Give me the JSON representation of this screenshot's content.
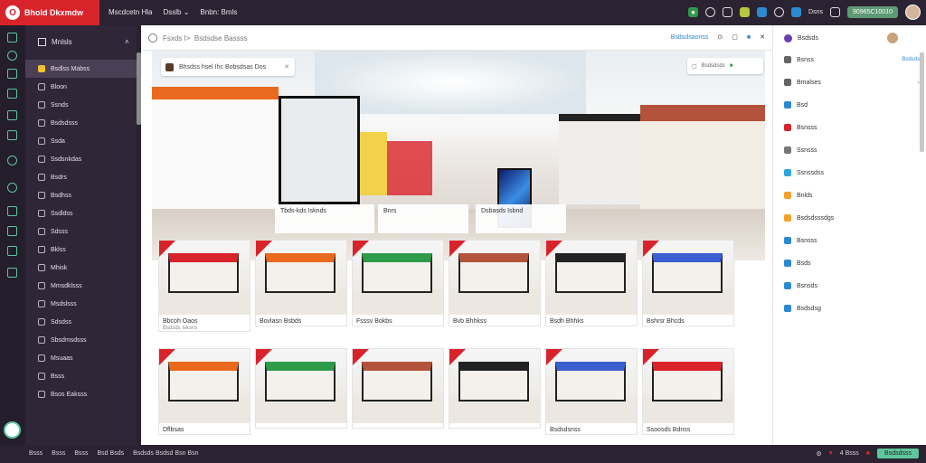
{
  "app": {
    "logo_letter": "O",
    "name": "Bhold Dkxmdw",
    "accent": "#d9232b"
  },
  "topnav": [
    "Mscdcetn Hla",
    "Dsslb",
    "Bnbn: Bmls"
  ],
  "topbar_right": {
    "label": "Dsns",
    "wallet": "90965C10010"
  },
  "sidebar": {
    "header": "Mnlsls",
    "items": [
      {
        "label": "Bsdlss Mabss"
      },
      {
        "label": "Bloon"
      },
      {
        "label": "Ssnds"
      },
      {
        "label": "Bsdsdsss"
      },
      {
        "label": "Ssda"
      },
      {
        "label": "Ssdsnkdas"
      },
      {
        "label": "Bsdrs"
      },
      {
        "label": "Bsdhss"
      },
      {
        "label": "Ssdldss"
      },
      {
        "label": "Sdsss"
      },
      {
        "label": "Bklss"
      },
      {
        "label": "Mhisk"
      },
      {
        "label": "Mmsdklsss"
      },
      {
        "label": "Msdslsss"
      },
      {
        "label": "Sdsdss"
      },
      {
        "label": "Sbsdmsdsss"
      },
      {
        "label": "Msuaas"
      },
      {
        "label": "Bsss"
      },
      {
        "label": "Bsos Eaksss"
      }
    ]
  },
  "search": {
    "prefix": "Fsxds I>",
    "text": "Bsdsdse Bassss",
    "link": "Bsdsdsaonss"
  },
  "hero": {
    "search_text": "Bhsdss hsel Ihc Bobsdsas Dos",
    "pill_text": "Bsdsdsds",
    "labels": [
      {
        "title": "Tbds-kds Isknds",
        "sub": ""
      },
      {
        "title": "Bnrs",
        "sub": ""
      },
      {
        "title": "Dsbasds Isbnd",
        "sub": ""
      }
    ]
  },
  "cards": [
    {
      "title": "Bbcoh Oaos",
      "sub": "Bsdsds Isksns"
    },
    {
      "title": "Bovlasn Bsbds",
      "sub": ""
    },
    {
      "title": "Fsssv Bokbs",
      "sub": ""
    },
    {
      "title": "Bvb Bhhkss",
      "sub": ""
    },
    {
      "title": "Bsdh Bhhks",
      "sub": ""
    },
    {
      "title": "Bshrsr Bhcds",
      "sub": ""
    },
    {
      "title": "Dflbsas",
      "sub": ""
    },
    {
      "title": "",
      "sub": ""
    },
    {
      "title": "",
      "sub": ""
    },
    {
      "title": "",
      "sub": ""
    },
    {
      "title": "Bsdsdsnss",
      "sub": ""
    },
    {
      "title": "Ssoosds Bdnss",
      "sub": ""
    }
  ],
  "rpanel": {
    "header": "Bsdsds",
    "items": [
      {
        "label": "Bsnss",
        "extra": "Bsdsds",
        "color": "#666"
      },
      {
        "label": "Bmalses",
        "extra": "",
        "color": "#666"
      },
      {
        "label": "Bsd",
        "extra": "",
        "color": "#2a8ad0"
      },
      {
        "label": "Bsnsss",
        "extra": "",
        "color": "#d9232b"
      },
      {
        "label": "Ssnsss",
        "extra": "",
        "color": "#777"
      },
      {
        "label": "Ssnssdss",
        "extra": "",
        "color": "#2aa7d8"
      },
      {
        "label": "Bnlds",
        "extra": "",
        "color": "#f2a12c"
      },
      {
        "label": "Bsdsdsssdgs",
        "extra": "",
        "color": "#f2a12c"
      },
      {
        "label": "Bsnsss",
        "extra": "",
        "color": "#2a8ad0"
      },
      {
        "label": "Bsds",
        "extra": "",
        "color": "#2a8ad0"
      },
      {
        "label": "Bsnsds",
        "extra": "",
        "color": "#2a8ad0"
      },
      {
        "label": "Bsdsdsg",
        "extra": "",
        "color": "#2a8ad0"
      }
    ]
  },
  "statusbar": {
    "left": [
      "Bsss",
      "Bsss",
      "Bsss",
      "Bsd Bsds",
      "Bsdsds Bsdsd Bsn Bsn"
    ],
    "right_label": "4 Bsss",
    "right_button": "Bsdsdsss"
  }
}
